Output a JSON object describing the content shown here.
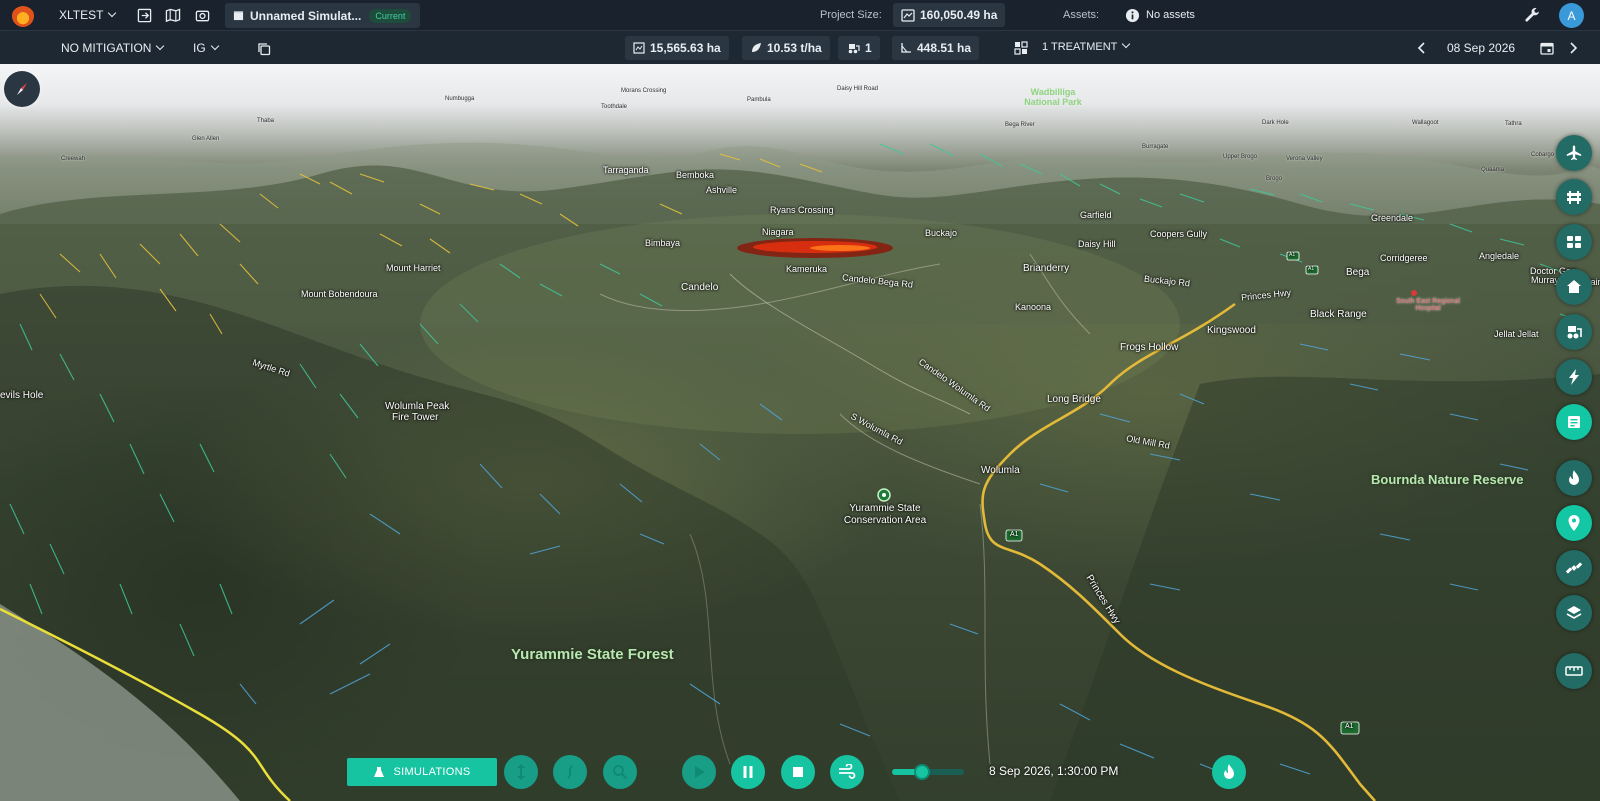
{
  "header": {
    "project_name": "XLTEST",
    "simulation_name": "Unnamed Simulat...",
    "simulation_badge": "Current",
    "project_size_label": "Project Size:",
    "project_size_value": "160,050.49 ha",
    "assets_label": "Assets:",
    "assets_value": "No assets",
    "avatar_initial": "A"
  },
  "subbar": {
    "mitigation": "NO MITIGATION",
    "ig": "IG",
    "area": "15,565.63 ha",
    "fuel_load": "10.53 t/ha",
    "units": "1",
    "perimeter": "448.51 ha",
    "treatment": "1 TREATMENT",
    "date": "08 Sep 2026"
  },
  "map_labels": {
    "places": [
      "Candelo",
      "Kameruka",
      "Brianderry",
      "Kingswood",
      "Frogs Hollow",
      "Long Bridge",
      "Wolumla",
      "Bega",
      "Black Range",
      "Jellat Jellat",
      "Corridgeree",
      "Greendale",
      "Angledale",
      "Kanoona",
      "Buckajo",
      "Bimbaya",
      "Niagara",
      "Ryans Crossing",
      "Daisy Hill",
      "Coopers Gully",
      "Garfield",
      "Mount Harriet",
      "Mount Bobendoura",
      "Wolumla Peak",
      "Fire Tower",
      "evils Hole",
      "Ashville",
      "Bemboka",
      "Tarraganda",
      "Murray Flat",
      "Doctor Geo",
      "ntain",
      "Burragate",
      "Upper Brogo",
      "Verona Valley",
      "Brogo",
      "Quaama",
      "Cobargo",
      "Dark Hole",
      "Glen Allen",
      "Creewah",
      "Thaba",
      "Bega River",
      "Numbugga",
      "Morans Crossing",
      "Pambula",
      "Toothdale",
      "Wallagoot",
      "Tathra",
      "Daisy Hill Road"
    ],
    "roads": [
      "Myrtle Rd",
      "Candelo Wolumla Rd",
      "S Wolumla Rd",
      "Old Mill Rd",
      "Princes Hwy",
      "Candelo Bega Rd",
      "Buckajo Rd",
      "Princes Hwy"
    ],
    "road_shields": [
      "A1",
      "A1",
      "A1",
      "A1"
    ],
    "parks": [
      "Yurammie State Forest",
      "Bournda Nature Reserve",
      "Yurammie State Conservation Area",
      "Wadbilliga National Park"
    ],
    "hospital": "South East Regional Hospital"
  },
  "bottom_toolbar": {
    "simulations_label": "SIMULATIONS",
    "datetime": "8 Sep 2026, 1:30:00 PM",
    "slider_value": 0.42
  },
  "side_toolbar": {
    "icons": [
      "aircraft-icon",
      "barrier-icon",
      "vehicles-icon",
      "home-icon",
      "bulldozer-icon",
      "lightning-icon",
      "notes-icon",
      "fire-icon",
      "location-pin-icon",
      "satellite-icon",
      "layers-icon",
      "ruler-icon"
    ]
  },
  "colors": {
    "accent": "#16c4a2",
    "topbar": "#19222d",
    "fire": "#e0300f"
  }
}
